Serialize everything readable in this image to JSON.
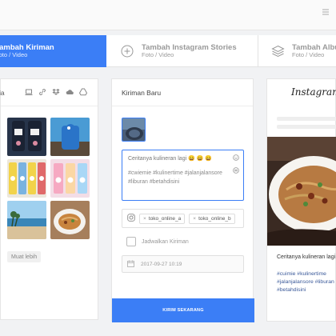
{
  "tabs": [
    {
      "title": "Tambah Kiriman",
      "subtitle": "Foto / Video",
      "active": true
    },
    {
      "title": "Tambah Instagram Stories",
      "subtitle": "Foto / Video",
      "active": false,
      "icon": "plus-circle-icon"
    },
    {
      "title": "Tambah Album",
      "subtitle": "Foto / Video",
      "active": false,
      "icon": "layers-icon"
    }
  ],
  "media_panel": {
    "label": "ia",
    "source_icons": [
      "laptop-icon",
      "link-icon",
      "dropbox-icon",
      "cloud-icon",
      "google-drive-icon"
    ],
    "load_more_label": "Muat lebih"
  },
  "composer": {
    "heading": "Kiriman Baru",
    "caption_text": "Ceritanya kulineran lagi 😄 😄 😄",
    "caption_tags": "#cwiemie #kulinertime #jalanjalansore #liburan #betahdisini",
    "accounts": [
      "toko_online_a",
      "toko_online_b"
    ],
    "schedule_label": "Jadwalkan Kiriman",
    "schedule_date": "2017-09-27 10:19",
    "send_label": "KIRIM SEKARANG"
  },
  "preview": {
    "brand": "Instagram",
    "caption": "Ceritanya kulineran lagi",
    "tags": "#cuimie #kulinertime #jalanjalansore #liburan #betahdisini"
  },
  "colors": {
    "accent": "#3b7ef6",
    "tag_link": "#3b5a9a"
  }
}
